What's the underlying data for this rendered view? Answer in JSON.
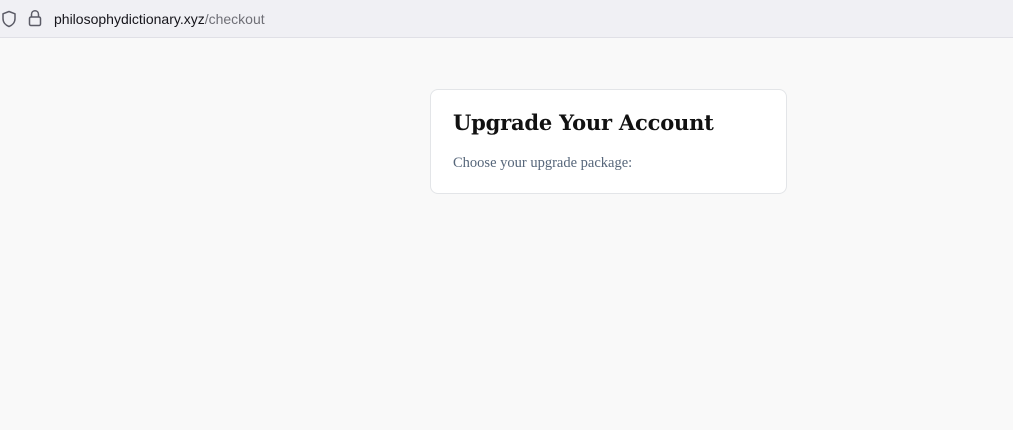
{
  "browser": {
    "url_host": "philosophydictionary.xyz",
    "url_path": "/checkout",
    "icons": [
      "shield-icon",
      "lock-icon"
    ]
  },
  "card": {
    "title": "Upgrade Your Account",
    "subtitle": "Choose your upgrade package:"
  },
  "colors": {
    "page_background": "#f9f9f9",
    "card_background": "#ffffff",
    "title_text": "#111111",
    "subtitle_text": "#56667a"
  }
}
